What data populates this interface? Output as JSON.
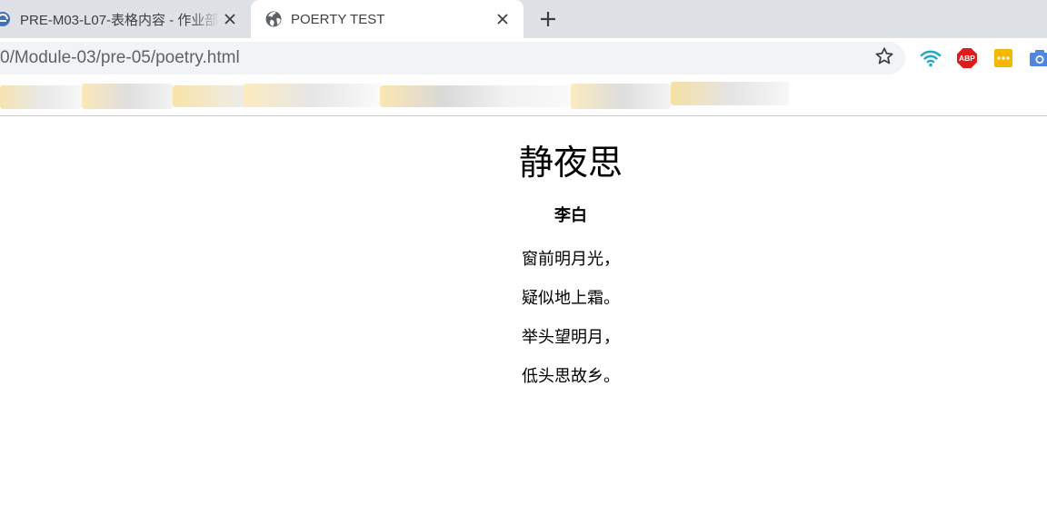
{
  "browser": {
    "tabs": [
      {
        "title": "PRE-M03-L07-表格内容 - 作业部",
        "state": "inactive",
        "favicon": "site-favicon"
      },
      {
        "title": "POERTY TEST",
        "state": "active",
        "favicon": "globe-icon"
      }
    ],
    "new_tab_symbol": "+",
    "close_symbol": "×",
    "address_bar": {
      "url": "0/Module-03/pre-05/poetry.html"
    },
    "extensions": [
      "wifi-icon",
      "adblock-plus-icon",
      "sticky-note-icon",
      "camera-icon"
    ],
    "extension_labels": {
      "abp": "ABP"
    },
    "colors": {
      "tabstrip": "#dee1e6",
      "omnibox": "#f1f3f4",
      "wifi": "#1ea7c7",
      "abp": "#e01b1b",
      "sticky": "#f5b800",
      "camera": "#4e86e0"
    }
  },
  "page": {
    "title": "静夜思",
    "author": "李白",
    "lines": [
      "窗前明月光，",
      "疑似地上霜。",
      "举头望明月，",
      "低头思故乡。"
    ]
  }
}
